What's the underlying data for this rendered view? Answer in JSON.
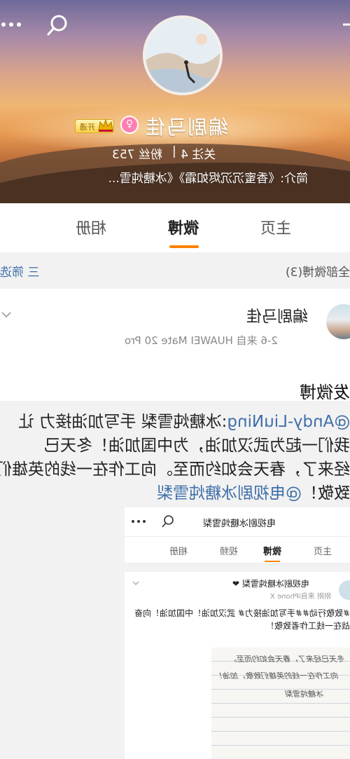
{
  "header": {
    "profile_name": "编剧马佳",
    "vip_label": "开通",
    "gender_symbol": "♀",
    "following": "关注 4",
    "separator": "|",
    "followers": "粉丝 753",
    "bio": "简介:《香蜜沉沉烬如霜》《冰糖炖雪..."
  },
  "tabs": {
    "home": "主页",
    "weibo": "微博",
    "album": "相册"
  },
  "filter": {
    "all_count": "全部微博(3)",
    "filter_label": "三 筛选"
  },
  "post": {
    "username": "编剧马佳",
    "meta": "2-6  来自 HUAWEI Mate 20 Pro",
    "title": "发微博",
    "body": {
      "line1_prefix": "@Andy-LiuNing",
      "line1_rest": ":冰糖炖雪梨 手写加油接力 让",
      "line2": "我们一起为武汉加油，为中国加油！冬天已",
      "line3": "经来了，春天会如约而至。向工作在一线的英雄们",
      "line4_plain": "致敬！",
      "line4_link": "@电视剧冰糖炖雪梨"
    },
    "embed": {
      "title": "电视剧冰糖炖雪梨",
      "tab_home": "主页",
      "tab_weibo": "微博",
      "tab_video": "视频",
      "tab_album": "相册",
      "user": "电视剧冰糖炖雪梨 ❤",
      "meta": "刚刚 来自iPhone X",
      "text1": "#致敬行动##手写加油接力# 武汉加油！中国加油！向奋",
      "text2": "战在一线工作者致敬！",
      "handwriting1": "冬天已经来了，春天会如约而至。",
      "handwriting2": "向工作在一线的英雄们致敬，加油！",
      "handwriting3": "冰糖炖雪梨"
    }
  },
  "colors": {
    "accent": "#ff8200",
    "link": "#3f6fa8"
  }
}
